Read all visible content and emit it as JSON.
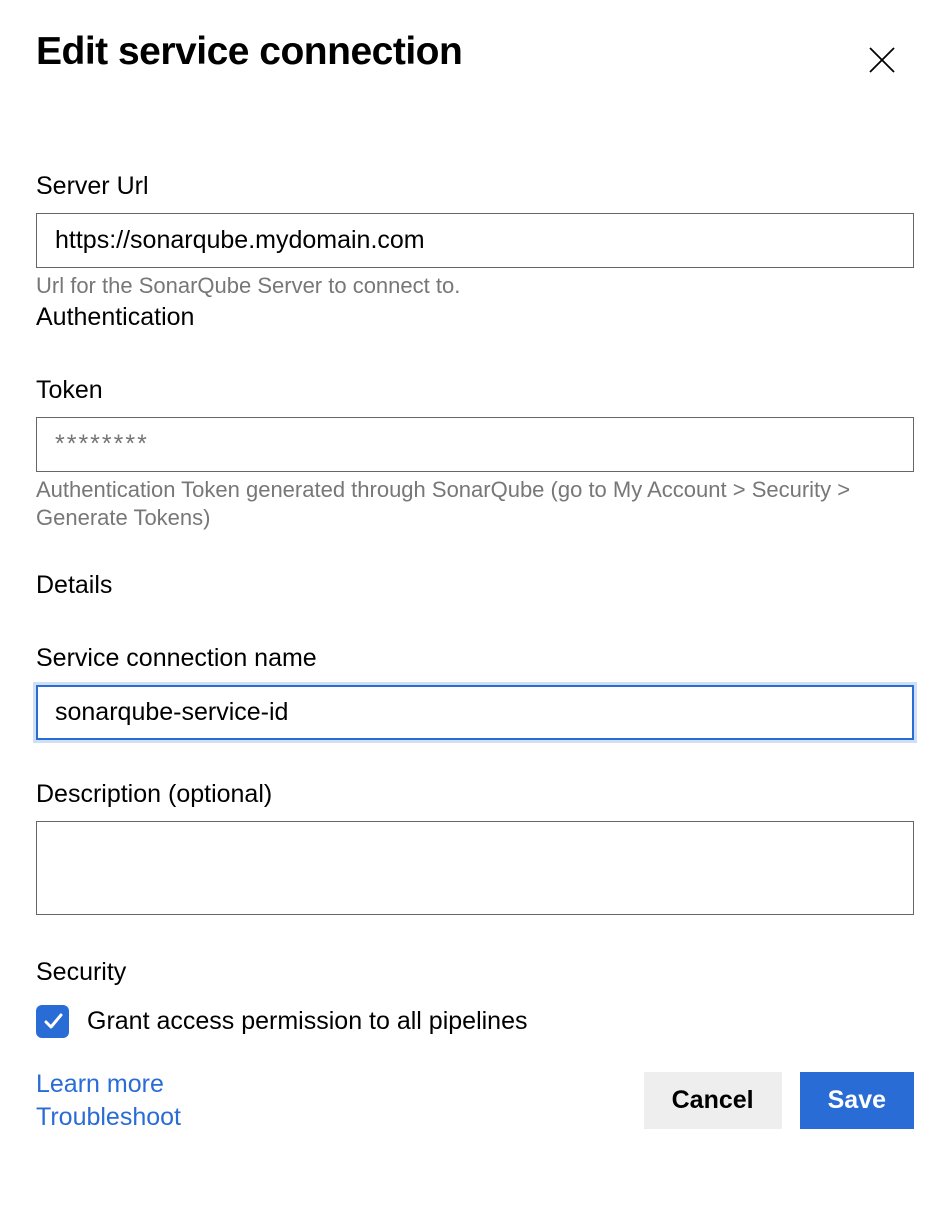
{
  "header": {
    "title": "Edit service connection"
  },
  "serverUrl": {
    "label": "Server Url",
    "value": "https://sonarqube.mydomain.com",
    "helper": "Url for the SonarQube Server to connect to."
  },
  "authentication": {
    "heading": "Authentication"
  },
  "token": {
    "label": "Token",
    "placeholder": "********",
    "value": "",
    "helper": "Authentication Token generated through SonarQube (go to My Account > Security > Generate Tokens)"
  },
  "details": {
    "heading": "Details"
  },
  "connectionName": {
    "label": "Service connection name",
    "value": "sonarqube-service-id"
  },
  "description": {
    "label": "Description (optional)",
    "value": ""
  },
  "security": {
    "heading": "Security",
    "grantAccess": {
      "checked": true,
      "label": "Grant access permission to all pipelines"
    }
  },
  "footer": {
    "learnMore": "Learn more",
    "troubleshoot": "Troubleshoot",
    "cancel": "Cancel",
    "save": "Save"
  }
}
